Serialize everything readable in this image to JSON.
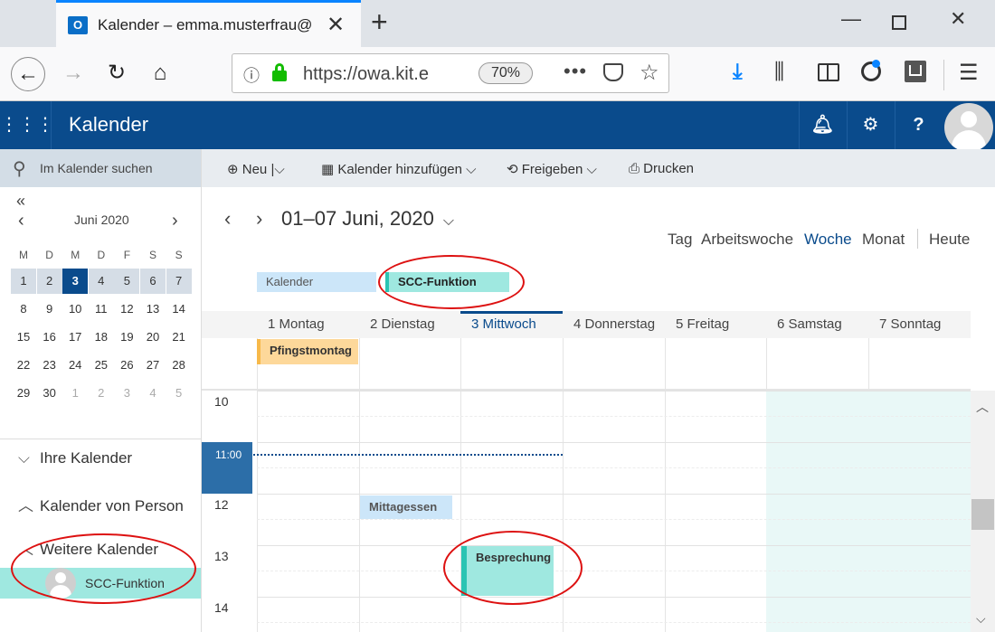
{
  "browser": {
    "tab_title": "Kalender – emma.musterfrau@",
    "tab_icon_letter": "O",
    "url": "https://owa.kit.e",
    "zoom": "70%"
  },
  "app": {
    "title": "Kalender"
  },
  "commands": {
    "new": "Neu",
    "add_calendar": "Kalender hinzufügen",
    "share": "Freigeben",
    "print": "Drucken"
  },
  "sidebar": {
    "search_placeholder": "Im Kalender suchen",
    "mini_month": "Juni 2020",
    "weekdays": [
      "M",
      "D",
      "M",
      "D",
      "F",
      "S",
      "S"
    ],
    "weeks": [
      [
        "1",
        "2",
        "3",
        "4",
        "5",
        "6",
        "7"
      ],
      [
        "8",
        "9",
        "10",
        "11",
        "12",
        "13",
        "14"
      ],
      [
        "15",
        "16",
        "17",
        "18",
        "19",
        "20",
        "21"
      ],
      [
        "22",
        "23",
        "24",
        "25",
        "26",
        "27",
        "28"
      ],
      [
        "29",
        "30",
        "1",
        "2",
        "3",
        "4",
        "5"
      ]
    ],
    "sections": {
      "own": "Ihre Kalender",
      "people": "Kalender von Person",
      "other": "Weitere Kalender"
    },
    "shared_calendar": "SCC-Funktion"
  },
  "main": {
    "date_range": "01–07 Juni, 2020",
    "views": {
      "day": "Tag",
      "workweek": "Arbeitswoche",
      "week": "Woche",
      "month": "Monat",
      "today": "Heute"
    },
    "calendar_chips": {
      "own": "Kalender",
      "shared": "SCC-Funktion"
    },
    "day_headers": [
      "1 Montag",
      "2 Dienstag",
      "3 Mittwoch",
      "4 Donnerstag",
      "5 Freitag",
      "6 Samstag",
      "7 Sonntag"
    ],
    "hours": [
      "10",
      "11:00",
      "12",
      "13",
      "14"
    ],
    "events": {
      "allday": "Pfingstmontag",
      "lunch": "Mittagessen",
      "meeting": "Besprechung"
    }
  },
  "colors": {
    "accent": "#0a4b8c",
    "shared_calendar": "#9fe8e0",
    "own_calendar": "#cce6f9",
    "holiday": "#fdd89a",
    "annotation": "#d11111"
  }
}
